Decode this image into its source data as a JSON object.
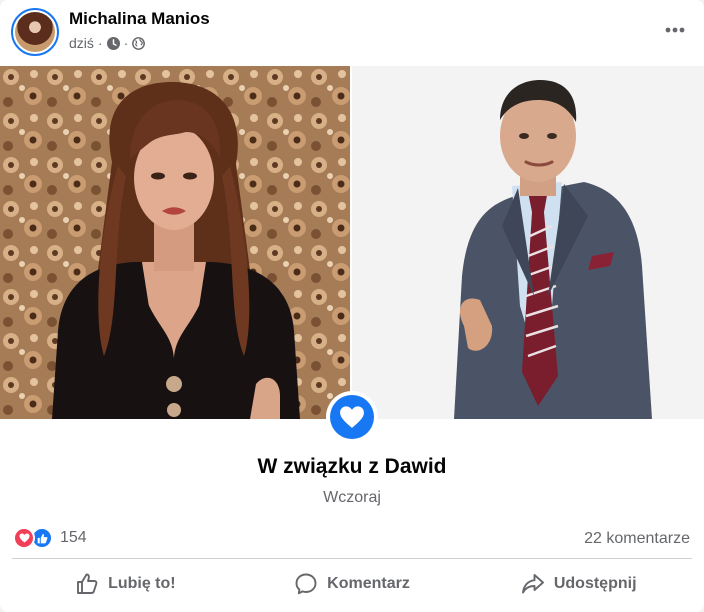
{
  "post": {
    "author": "Michalina Manios",
    "time": "dziś",
    "separator": "·"
  },
  "event": {
    "title": "W związku z Dawid",
    "date": "Wczoraj"
  },
  "stats": {
    "reactions_count": "154",
    "comments_count": "22 komentarze"
  },
  "actions": {
    "like": "Lubię to!",
    "comment": "Komentarz",
    "share": "Udostępnij"
  },
  "icons": {
    "clock": "clock-icon",
    "globe": "globe-icon",
    "more": "more-options-icon",
    "heart": "heart-icon",
    "love_reaction": "love-reaction-icon",
    "like_reaction": "like-reaction-icon",
    "like_action": "thumbs-up-icon",
    "comment_action": "comment-bubble-icon",
    "share_action": "share-arrow-icon"
  },
  "colors": {
    "brand_blue": "#1877f2",
    "love_red": "#f33e58",
    "secondary_text": "#65676b"
  }
}
